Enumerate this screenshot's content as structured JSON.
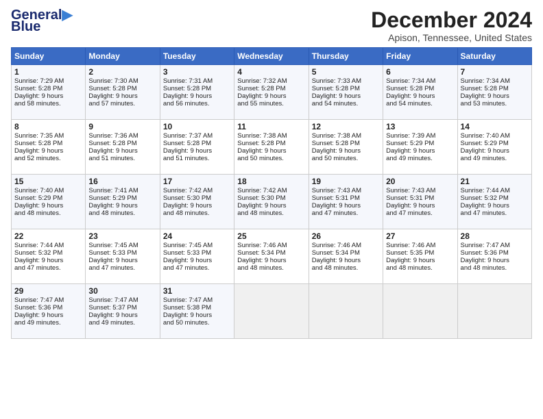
{
  "logo": {
    "line1": "General",
    "line2": "Blue"
  },
  "title": "December 2024",
  "location": "Apison, Tennessee, United States",
  "days_of_week": [
    "Sunday",
    "Monday",
    "Tuesday",
    "Wednesday",
    "Thursday",
    "Friday",
    "Saturday"
  ],
  "weeks": [
    [
      {
        "day": 1,
        "sunrise": "7:29 AM",
        "sunset": "5:28 PM",
        "daylight": "9 hours and 58 minutes."
      },
      {
        "day": 2,
        "sunrise": "7:30 AM",
        "sunset": "5:28 PM",
        "daylight": "9 hours and 57 minutes."
      },
      {
        "day": 3,
        "sunrise": "7:31 AM",
        "sunset": "5:28 PM",
        "daylight": "9 hours and 56 minutes."
      },
      {
        "day": 4,
        "sunrise": "7:32 AM",
        "sunset": "5:28 PM",
        "daylight": "9 hours and 55 minutes."
      },
      {
        "day": 5,
        "sunrise": "7:33 AM",
        "sunset": "5:28 PM",
        "daylight": "9 hours and 54 minutes."
      },
      {
        "day": 6,
        "sunrise": "7:34 AM",
        "sunset": "5:28 PM",
        "daylight": "9 hours and 54 minutes."
      },
      {
        "day": 7,
        "sunrise": "7:34 AM",
        "sunset": "5:28 PM",
        "daylight": "9 hours and 53 minutes."
      }
    ],
    [
      {
        "day": 8,
        "sunrise": "7:35 AM",
        "sunset": "5:28 PM",
        "daylight": "9 hours and 52 minutes."
      },
      {
        "day": 9,
        "sunrise": "7:36 AM",
        "sunset": "5:28 PM",
        "daylight": "9 hours and 51 minutes."
      },
      {
        "day": 10,
        "sunrise": "7:37 AM",
        "sunset": "5:28 PM",
        "daylight": "9 hours and 51 minutes."
      },
      {
        "day": 11,
        "sunrise": "7:38 AM",
        "sunset": "5:28 PM",
        "daylight": "9 hours and 50 minutes."
      },
      {
        "day": 12,
        "sunrise": "7:38 AM",
        "sunset": "5:28 PM",
        "daylight": "9 hours and 50 minutes."
      },
      {
        "day": 13,
        "sunrise": "7:39 AM",
        "sunset": "5:29 PM",
        "daylight": "9 hours and 49 minutes."
      },
      {
        "day": 14,
        "sunrise": "7:40 AM",
        "sunset": "5:29 PM",
        "daylight": "9 hours and 49 minutes."
      }
    ],
    [
      {
        "day": 15,
        "sunrise": "7:40 AM",
        "sunset": "5:29 PM",
        "daylight": "9 hours and 48 minutes."
      },
      {
        "day": 16,
        "sunrise": "7:41 AM",
        "sunset": "5:29 PM",
        "daylight": "9 hours and 48 minutes."
      },
      {
        "day": 17,
        "sunrise": "7:42 AM",
        "sunset": "5:30 PM",
        "daylight": "9 hours and 48 minutes."
      },
      {
        "day": 18,
        "sunrise": "7:42 AM",
        "sunset": "5:30 PM",
        "daylight": "9 hours and 48 minutes."
      },
      {
        "day": 19,
        "sunrise": "7:43 AM",
        "sunset": "5:31 PM",
        "daylight": "9 hours and 47 minutes."
      },
      {
        "day": 20,
        "sunrise": "7:43 AM",
        "sunset": "5:31 PM",
        "daylight": "9 hours and 47 minutes."
      },
      {
        "day": 21,
        "sunrise": "7:44 AM",
        "sunset": "5:32 PM",
        "daylight": "9 hours and 47 minutes."
      }
    ],
    [
      {
        "day": 22,
        "sunrise": "7:44 AM",
        "sunset": "5:32 PM",
        "daylight": "9 hours and 47 minutes."
      },
      {
        "day": 23,
        "sunrise": "7:45 AM",
        "sunset": "5:33 PM",
        "daylight": "9 hours and 47 minutes."
      },
      {
        "day": 24,
        "sunrise": "7:45 AM",
        "sunset": "5:33 PM",
        "daylight": "9 hours and 47 minutes."
      },
      {
        "day": 25,
        "sunrise": "7:46 AM",
        "sunset": "5:34 PM",
        "daylight": "9 hours and 48 minutes."
      },
      {
        "day": 26,
        "sunrise": "7:46 AM",
        "sunset": "5:34 PM",
        "daylight": "9 hours and 48 minutes."
      },
      {
        "day": 27,
        "sunrise": "7:46 AM",
        "sunset": "5:35 PM",
        "daylight": "9 hours and 48 minutes."
      },
      {
        "day": 28,
        "sunrise": "7:47 AM",
        "sunset": "5:36 PM",
        "daylight": "9 hours and 48 minutes."
      }
    ],
    [
      {
        "day": 29,
        "sunrise": "7:47 AM",
        "sunset": "5:36 PM",
        "daylight": "9 hours and 49 minutes."
      },
      {
        "day": 30,
        "sunrise": "7:47 AM",
        "sunset": "5:37 PM",
        "daylight": "9 hours and 49 minutes."
      },
      {
        "day": 31,
        "sunrise": "7:47 AM",
        "sunset": "5:38 PM",
        "daylight": "9 hours and 50 minutes."
      },
      null,
      null,
      null,
      null
    ]
  ],
  "labels": {
    "sunrise": "Sunrise:",
    "sunset": "Sunset:",
    "daylight": "Daylight:"
  }
}
